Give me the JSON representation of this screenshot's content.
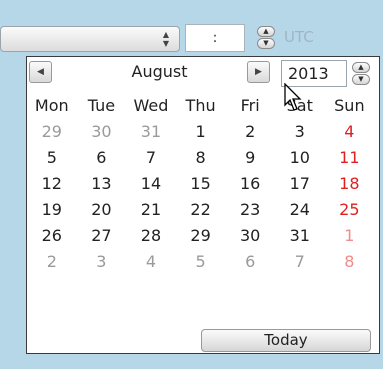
{
  "time_field": {
    "value": ":"
  },
  "timezone": {
    "label": "UTC"
  },
  "calendar": {
    "month": "August",
    "year": "2013",
    "weekday_headers": [
      "Mon",
      "Tue",
      "Wed",
      "Thu",
      "Fri",
      "Sat",
      "Sun"
    ],
    "weeks": [
      [
        "29",
        "30",
        "31",
        "1",
        "2",
        "3",
        "4"
      ],
      [
        "5",
        "6",
        "7",
        "8",
        "9",
        "10",
        "11"
      ],
      [
        "12",
        "13",
        "14",
        "15",
        "16",
        "17",
        "18"
      ],
      [
        "19",
        "20",
        "21",
        "22",
        "23",
        "24",
        "25"
      ],
      [
        "26",
        "27",
        "28",
        "29",
        "30",
        "31",
        "1"
      ],
      [
        "2",
        "3",
        "4",
        "5",
        "6",
        "7",
        "8"
      ]
    ],
    "other_month_mask": [
      [
        true,
        true,
        true,
        false,
        false,
        false,
        false
      ],
      [
        false,
        false,
        false,
        false,
        false,
        false,
        false
      ],
      [
        false,
        false,
        false,
        false,
        false,
        false,
        false
      ],
      [
        false,
        false,
        false,
        false,
        false,
        false,
        false
      ],
      [
        false,
        false,
        false,
        false,
        false,
        false,
        true
      ],
      [
        true,
        true,
        true,
        true,
        true,
        true,
        true
      ]
    ],
    "today_label": "Today"
  },
  "icons": {
    "prev_month": "chevron-left-icon",
    "next_month": "chevron-right-icon",
    "spin": "spin-up-down-icon",
    "cursor": "mouse-pointer-icon"
  },
  "colors": {
    "background": "#b5d7e8",
    "sunday": "#e02020",
    "sunday_other": "#f08c8c",
    "other_month": "#9a9a9a",
    "timezone_text": "#9fb6c2"
  }
}
